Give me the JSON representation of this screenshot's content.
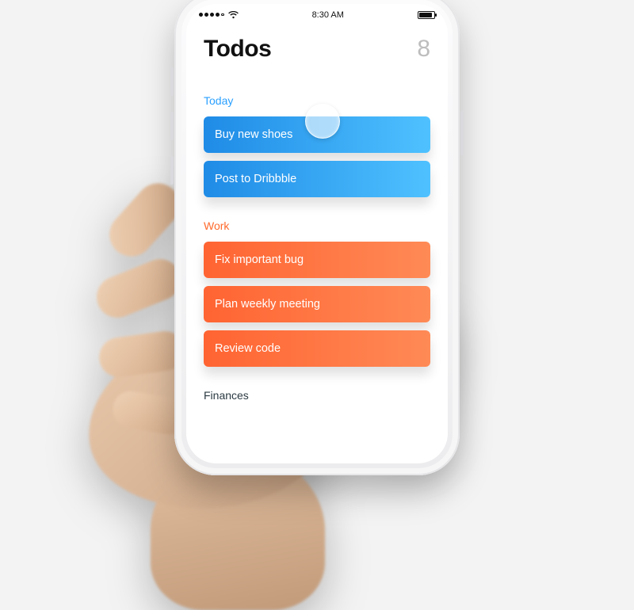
{
  "statusbar": {
    "time": "8:30 AM"
  },
  "header": {
    "title": "Todos",
    "count": "8"
  },
  "sections": {
    "today": {
      "label": "Today",
      "items": [
        "Buy new shoes",
        "Post to Dribbble"
      ]
    },
    "work": {
      "label": "Work",
      "items": [
        "Fix important bug",
        "Plan weekly meeting",
        "Review code"
      ]
    },
    "finances": {
      "label": "Finances"
    }
  }
}
